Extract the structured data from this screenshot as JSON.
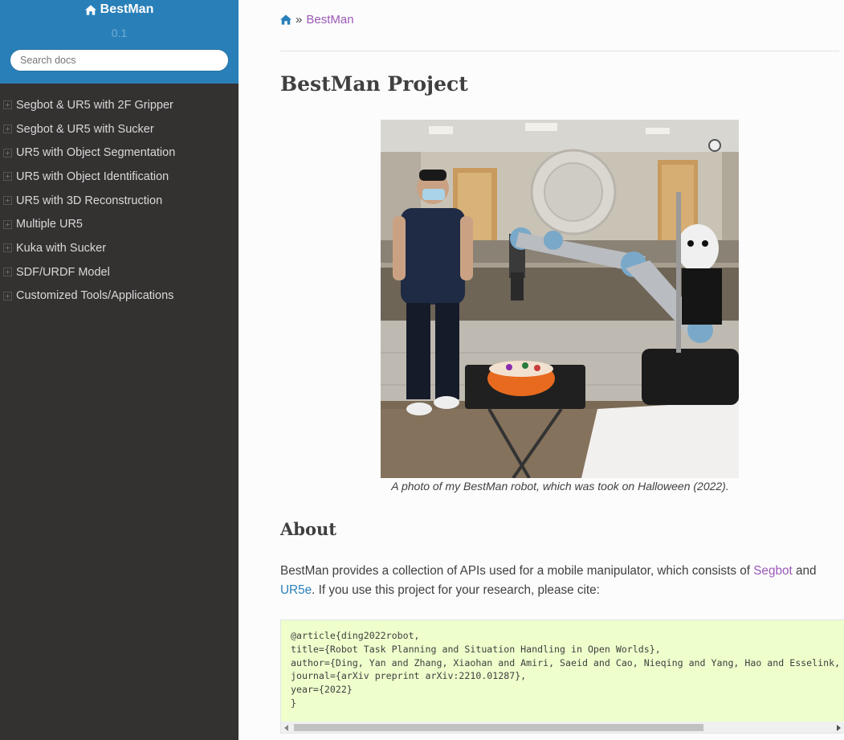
{
  "sidebar": {
    "project_name": "BestMan",
    "version": "0.1",
    "search_placeholder": "Search docs",
    "items": [
      {
        "label": "Segbot & UR5 with 2F Gripper"
      },
      {
        "label": "Segbot & UR5 with Sucker"
      },
      {
        "label": "UR5 with Object Segmentation"
      },
      {
        "label": "UR5 with Object Identification"
      },
      {
        "label": "UR5 with 3D Reconstruction"
      },
      {
        "label": "Multiple UR5"
      },
      {
        "label": "Kuka with Sucker"
      },
      {
        "label": "SDF/URDF Model"
      },
      {
        "label": "Customized Tools/Applications"
      }
    ]
  },
  "breadcrumb": {
    "separator": "»",
    "current": "BestMan"
  },
  "page": {
    "title": "BestMan Project",
    "figure_caption": "A photo of my BestMan robot, which was took on Halloween (2022).",
    "about_heading": "About",
    "about_text_1": "BestMan provides a collection of APIs used for a mobile manipulator, which consists of ",
    "about_link_1": "Segbot",
    "about_text_2": " and ",
    "about_link_2": "UR5e",
    "about_text_3": ". If you use this project for your research, please cite:",
    "citation": "@article{ding2022robot,\ntitle={Robot Task Planning and Situation Handling in Open Worlds},\nauthor={Ding, Yan and Zhang, Xiaohan and Amiri, Saeid and Cao, Nieqing and Yang, Hao and Esselink, Chad and Zhang, Shiqi},\njournal={arXiv preprint arXiv:2210.01287},\nyear={2022}\n}"
  },
  "colors": {
    "sidebar_header": "#2980b9",
    "sidebar_bg": "#343131",
    "link_visited": "#9b59b6",
    "link": "#2980b9",
    "code_bg": "#eeffcc"
  },
  "icons": {
    "brand": "home-icon",
    "breadcrumb_home": "home-icon",
    "nav_expand": "plus-square-icon"
  }
}
